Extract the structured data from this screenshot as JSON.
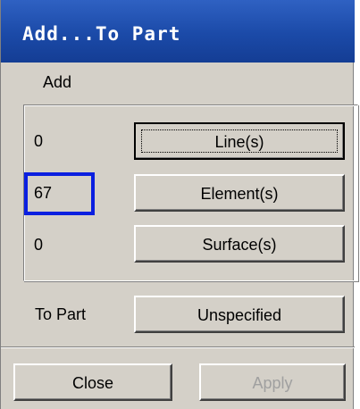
{
  "window": {
    "title": "Add...To Part"
  },
  "menu": {
    "add_label": "Add"
  },
  "rows": [
    {
      "count": "0",
      "button": "Line(s)"
    },
    {
      "count": "67",
      "button": "Element(s)"
    },
    {
      "count": "0",
      "button": "Surface(s)"
    }
  ],
  "to_part": {
    "label": "To Part",
    "value": "Unspecified"
  },
  "actions": {
    "close_label": "Close",
    "apply_label": "Apply"
  },
  "colors": {
    "title_bar": "#1b4aa8",
    "dialog_bg": "#d4d0c8",
    "highlight": "#0a1fe0"
  }
}
